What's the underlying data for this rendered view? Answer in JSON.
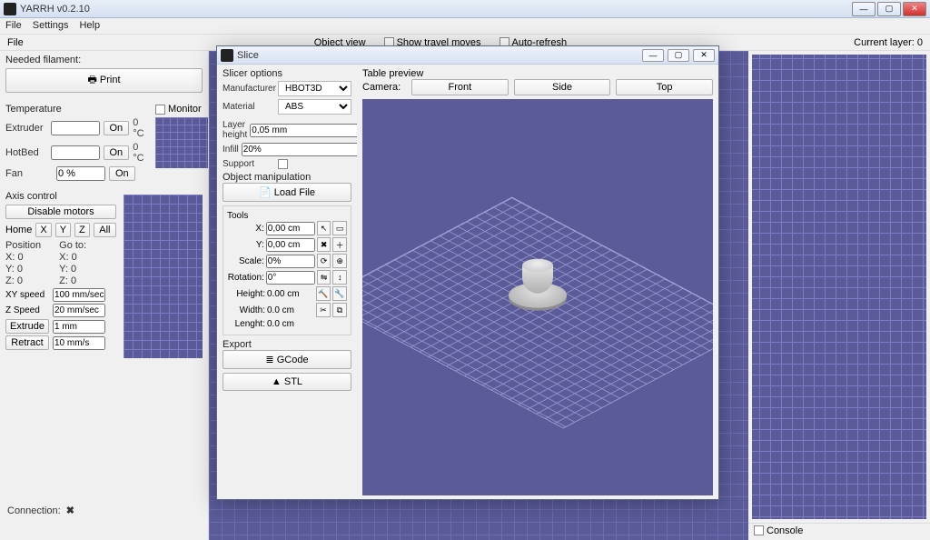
{
  "window": {
    "title": "YARRH v0.2.10"
  },
  "menu": {
    "file": "File",
    "settings": "Settings",
    "help": "Help"
  },
  "toprow": {
    "file_label": "File",
    "objectview_label": "Object view",
    "show_travel": "Show travel moves",
    "auto_refresh": "Auto-refresh",
    "current_layer_label": "Current layer:",
    "current_layer_val": "0"
  },
  "left": {
    "needed_filament": "Needed filament:",
    "print_btn": "Print",
    "temperature": "Temperature",
    "monitor": "Monitor",
    "extruder": "Extruder",
    "extruder_on": "On",
    "extruder_temp": "0 °C",
    "hotbed": "HotBed",
    "hotbed_on": "On",
    "hotbed_temp": "0 °C",
    "fan": "Fan",
    "fan_val": "0 %",
    "fan_on": "On",
    "axis_control": "Axis control",
    "disable_motors": "Disable motors",
    "home": "Home",
    "x": "X",
    "y": "Y",
    "z": "Z",
    "all": "All",
    "position": "Position",
    "goto": "Go to:",
    "x0": "X: 0",
    "y0": "Y: 0",
    "z0": "Z: 0",
    "xy_speed": "XY speed",
    "xy_speed_val": "100 mm/sec",
    "z_speed": "Z Speed",
    "z_speed_val": "20 mm/sec",
    "extrude": "Extrude",
    "extrude_val": "1 mm",
    "retract": "Retract",
    "retract_val": "10 mm/s"
  },
  "dialog": {
    "title": "Slice",
    "slicer_options": "Slicer options",
    "manufacturer": "Manufacturer",
    "manufacturer_val": "HBOT3D",
    "material": "Material",
    "material_val": "ABS",
    "layer_height": "Layer height",
    "layer_height_val": "0,05 mm",
    "infill": "Infill",
    "infill_val": "20%",
    "support": "Support",
    "object_manipulation": "Object manipulation",
    "load_file": "Load File",
    "tools": "Tools",
    "x": "X:",
    "x_val": "0,00 cm",
    "y": "Y:",
    "y_val": "0,00 cm",
    "scale": "Scale:",
    "scale_val": "0%",
    "rotation": "Rotation:",
    "rotation_val": "0°",
    "height": "Height:",
    "height_val": "0.00 cm",
    "width": "Width:",
    "width_val": "0.0 cm",
    "length": "Lenght:",
    "length_val": "0.0 cm",
    "export": "Export",
    "gcode": "GCode",
    "stl": "STL",
    "table_preview": "Table preview",
    "camera": "Camera:",
    "front": "Front",
    "side": "Side",
    "top": "Top"
  },
  "connection": {
    "label": "Connection:"
  },
  "console": {
    "label": "Console"
  }
}
